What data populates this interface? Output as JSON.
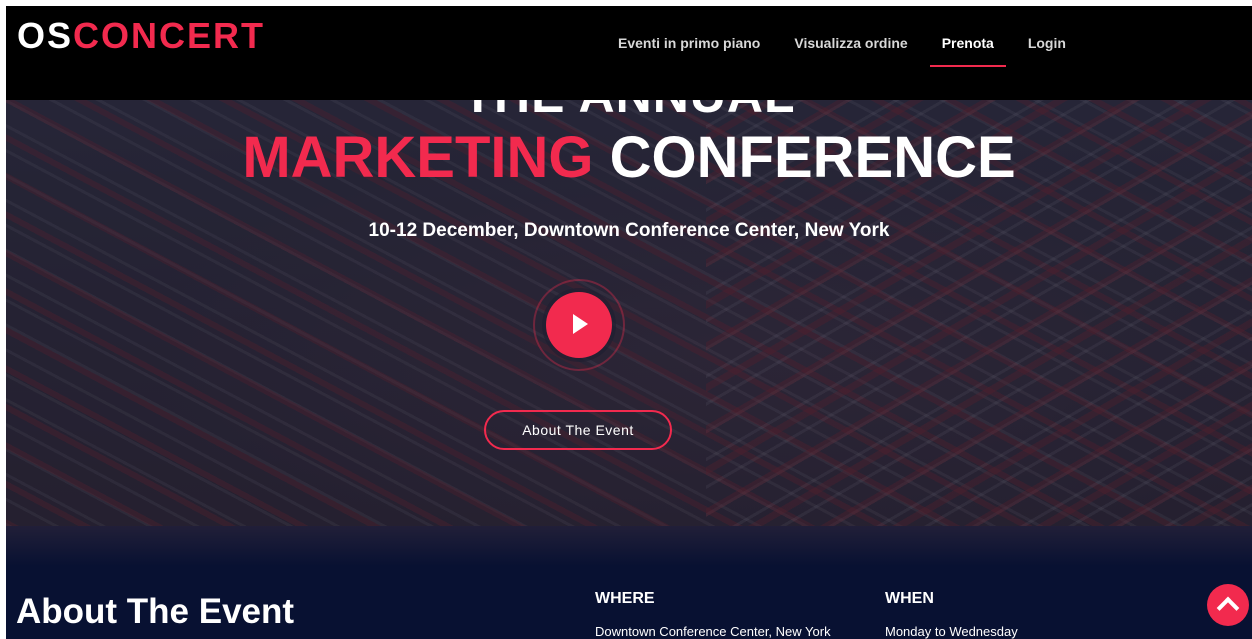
{
  "brand": {
    "logo_part1": "OS",
    "logo_part2": "CONCERT",
    "accent_color": "#f22a4e"
  },
  "nav": {
    "items": [
      {
        "label": "Eventi in primo piano",
        "active": false
      },
      {
        "label": "Visualizza ordine",
        "active": false
      },
      {
        "label": "Prenota",
        "active": true
      },
      {
        "label": "Login",
        "active": false
      }
    ]
  },
  "hero": {
    "partial_title": "THE ANNUAL",
    "title_highlight": "MARKETING",
    "title_rest": "CONFERENCE",
    "subtitle": "10-12 December, Downtown Conference Center, New York",
    "play_icon": "play-icon",
    "cta_label": "About The Event"
  },
  "about": {
    "title": "About The Event",
    "where_heading": "WHERE",
    "where_text": "Downtown Conference Center, New York",
    "when_heading": "WHEN",
    "when_text": "Monday to Wednesday"
  },
  "scroll_top_icon": "chevron-up-icon"
}
